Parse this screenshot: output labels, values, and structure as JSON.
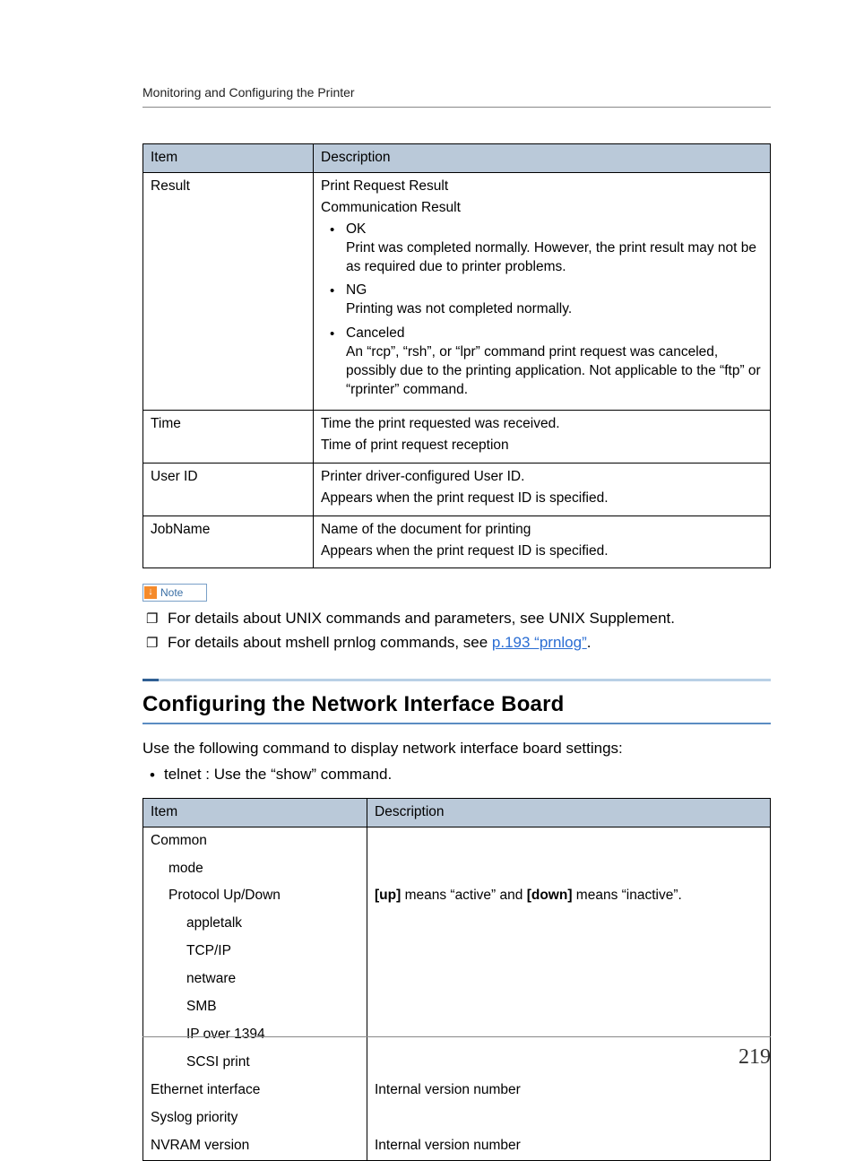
{
  "header": {
    "running_head": "Monitoring and Configuring the Printer"
  },
  "table1": {
    "col_item": "Item",
    "col_desc": "Description",
    "rows": {
      "result": {
        "item": "Result",
        "line1": "Print Request Result",
        "line2": "Communication Result",
        "b1_title": "OK",
        "b1_body": "Print was completed normally. However, the print result may not be as required due to printer problems.",
        "b2_title": "NG",
        "b2_body": "Printing was not completed normally.",
        "b3_title": "Canceled",
        "b3_body": "An “rcp”, “rsh”, or “lpr” command print request was canceled, possibly due to the printing application. Not applicable to the “ftp” or “rprinter” command."
      },
      "time": {
        "item": "Time",
        "line1": "Time the print requested was received.",
        "line2": "Time of print request reception"
      },
      "userid": {
        "item": "User ID",
        "line1": "Printer driver-configured User ID.",
        "line2": "Appears when the print request ID is specified."
      },
      "jobname": {
        "item": "JobName",
        "line1": "Name of the document for printing",
        "line2": "Appears when the print request ID is specified."
      }
    }
  },
  "note": {
    "label": "Note",
    "n1": "For details about UNIX commands and parameters, see UNIX Supplement.",
    "n2_pre": "For details about mshell prnlog commands, see ",
    "n2_link": "p.193 “prnlog”",
    "n2_post": "."
  },
  "section": {
    "title": "Configuring the Network Interface Board",
    "intro": "Use the following command to display network interface board settings:",
    "bullet1": "telnet : Use the “show” command."
  },
  "table2": {
    "col_item": "Item",
    "col_desc": "Description",
    "rows": {
      "common": {
        "item": "Common"
      },
      "mode": {
        "item": "mode"
      },
      "protocol": {
        "item": "Protocol Up/Down",
        "desc_pre": "[up]",
        "desc_mid1": " means “active” and ",
        "desc_mid2": "[down]",
        "desc_post": " means “inactive”."
      },
      "appletalk": {
        "item": "appletalk"
      },
      "tcpip": {
        "item": "TCP/IP"
      },
      "netware": {
        "item": "netware"
      },
      "smb": {
        "item": "SMB"
      },
      "ip1394": {
        "item": "IP over 1394"
      },
      "scsi": {
        "item": "SCSI print"
      },
      "ethernet": {
        "item": "Ethernet interface",
        "desc": "Internal version number"
      },
      "syslog": {
        "item": "Syslog priority"
      },
      "nvram": {
        "item": "NVRAM version",
        "desc": "Internal version number"
      }
    }
  },
  "footer": {
    "page": "219"
  }
}
